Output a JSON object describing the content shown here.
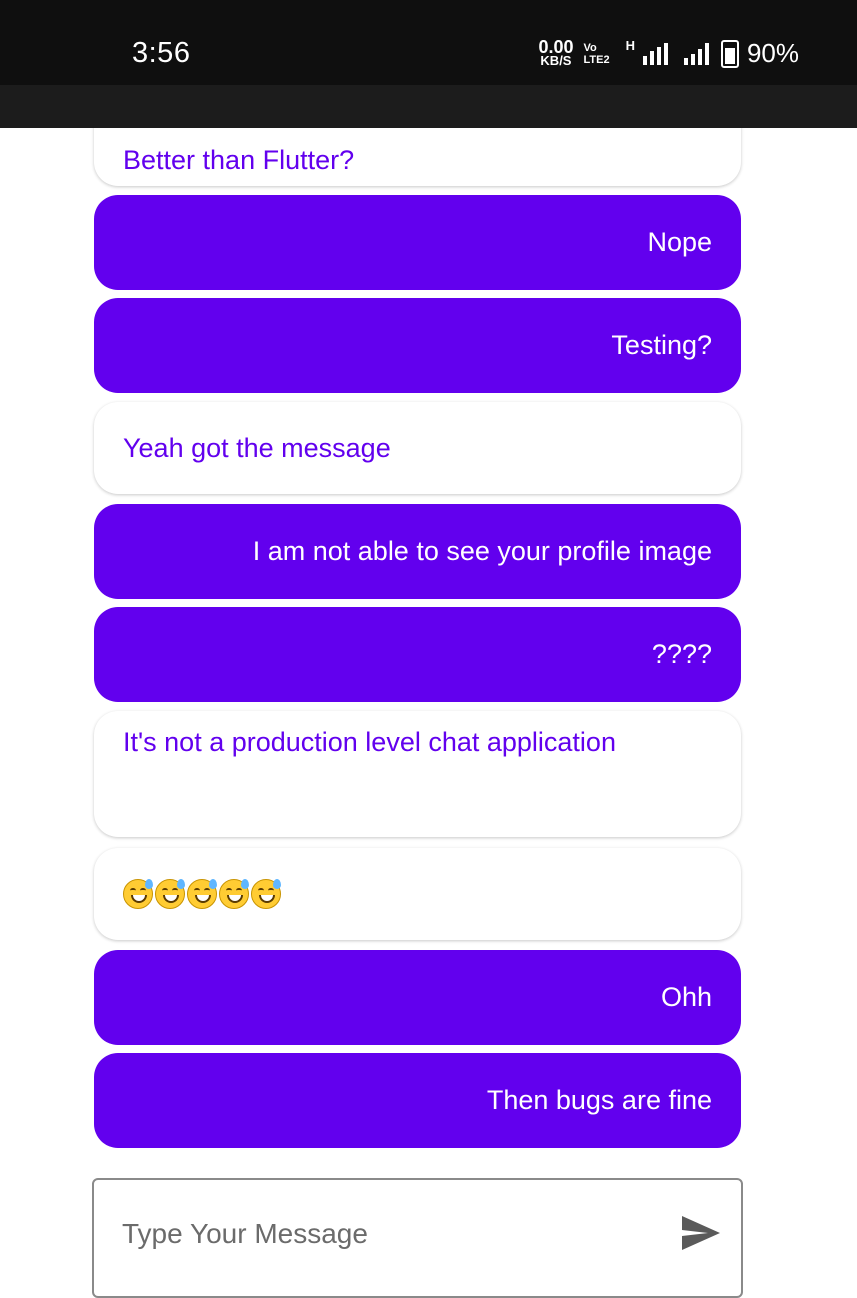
{
  "status_bar": {
    "time": "3:56",
    "net_speed_value": "0.00",
    "net_speed_unit": "KB/S",
    "volte_top": "Vo",
    "volte_bottom": "LTE2",
    "network_type": "H",
    "battery": "90%"
  },
  "messages": [
    {
      "direction": "incoming",
      "text": "Better than Flutter?"
    },
    {
      "direction": "outgoing",
      "text": "Nope"
    },
    {
      "direction": "outgoing",
      "text": "Testing?"
    },
    {
      "direction": "incoming",
      "text": "Yeah got the message"
    },
    {
      "direction": "outgoing",
      "text": "I am not able to see your profile image"
    },
    {
      "direction": "outgoing",
      "text": "????"
    },
    {
      "direction": "incoming",
      "text": "It's not a production level chat application"
    },
    {
      "direction": "incoming",
      "emoji": "grinning-face-with-sweat",
      "count": 5
    },
    {
      "direction": "outgoing",
      "text": "Ohh"
    },
    {
      "direction": "outgoing",
      "text": "Then bugs are fine"
    }
  ],
  "composer": {
    "placeholder": "Type Your Message",
    "value": "",
    "send_icon": "send-icon"
  },
  "colors": {
    "accent": "#6200ee",
    "status_bar": "#0f0f0f",
    "incoming_bg": "#ffffff"
  }
}
